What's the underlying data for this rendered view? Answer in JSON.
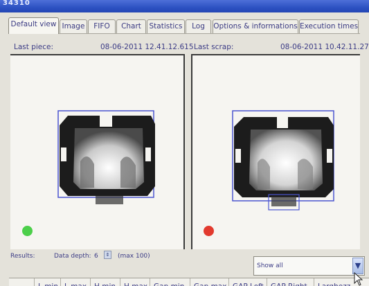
{
  "window": {
    "title": "34310"
  },
  "tabs": [
    {
      "label": "Default view",
      "active": true
    },
    {
      "label": "Image",
      "active": false
    },
    {
      "label": "FIFO",
      "active": false
    },
    {
      "label": "Chart",
      "active": false
    },
    {
      "label": "Statistics",
      "active": false
    },
    {
      "label": "Log",
      "active": false
    },
    {
      "label": "Options & informations",
      "active": false
    },
    {
      "label": "Execution times",
      "active": false
    }
  ],
  "last_piece": {
    "label": "Last piece:",
    "timestamp": "08-06-2011 12.41.12.615",
    "status_color": "#4ccf4a"
  },
  "last_scrap": {
    "label": "Last scrap:",
    "timestamp": "08-06-2011 10.42.11.272",
    "status_color": "#e23a2e"
  },
  "results": {
    "label": "Results:",
    "data_depth_label": "Data depth:",
    "data_depth_value": "6",
    "data_depth_max": "(max 100)"
  },
  "filter": {
    "selected": "Show all"
  },
  "columns": [
    "",
    "L min",
    "L max",
    "H min",
    "H max",
    "Gap min",
    "Gap max",
    "GAP Left",
    "GAP Right",
    "Larghezz"
  ],
  "colors": {
    "title_bar": "#2a4fc0",
    "text": "#3c3c86",
    "bounding_box": "#4a55d0"
  }
}
